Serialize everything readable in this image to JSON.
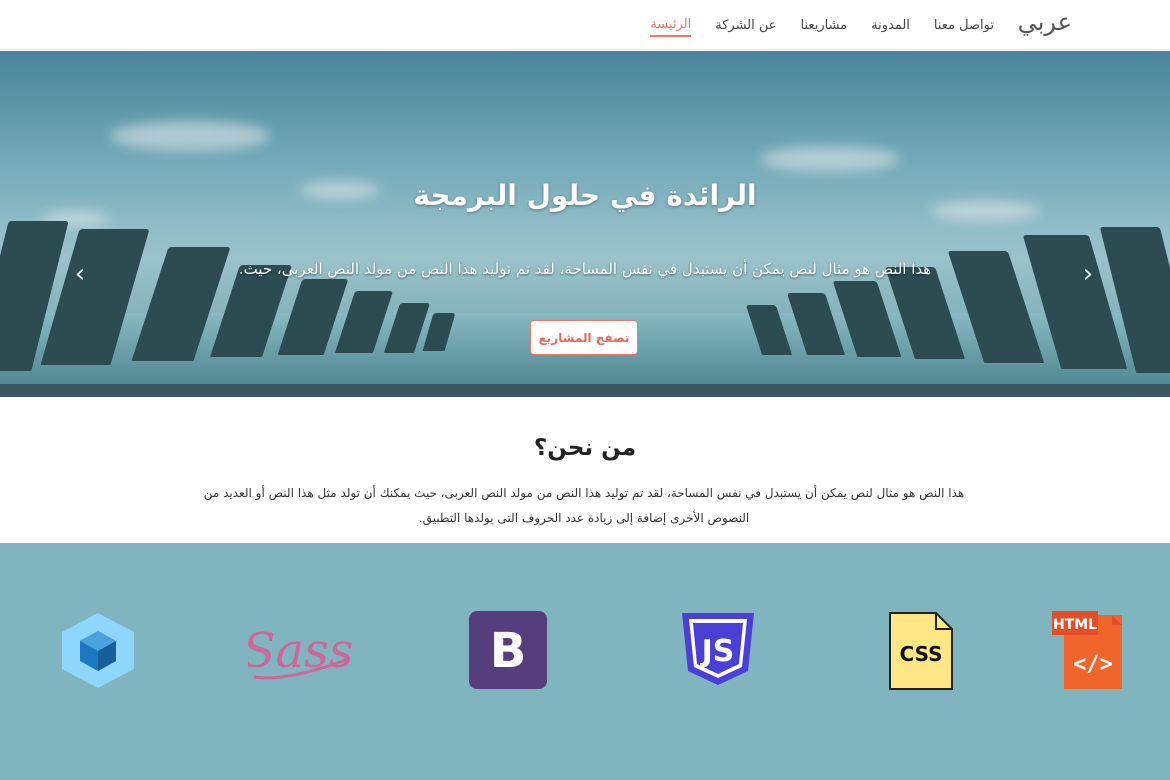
{
  "navbar": {
    "brand": "عربي",
    "items": [
      {
        "label": "الرئيسة",
        "active": true
      },
      {
        "label": "عن الشركة",
        "active": false
      },
      {
        "label": "مشاريعنا",
        "active": false
      },
      {
        "label": "المدونة",
        "active": false
      },
      {
        "label": "تواصل معنا",
        "active": false
      }
    ]
  },
  "hero": {
    "title": "الرائدة في حلول البرمجة",
    "text": "هذا النص هو مثال لنص يمكن أن يستبدل في نفس المساحة، لقد تم توليد هذا النص من مولد النص العربى، حيث.",
    "button_label": "تصفح المشاريع",
    "slides_count": 4,
    "active_slide": 3,
    "prev_icon": "chevron-left-icon",
    "next_icon": "chevron-right-icon"
  },
  "about": {
    "title": "من نحن؟",
    "text": "هذا النص هو مثال لنص يمكن أن يستبدل في نفس المساحة، لقد تم توليد هذا النص من مولد النص العربى، حيث يمكنك أن تولد مثل هذا النص أو العديد من النصوص الأخرى إضافة إلى زيادة عدد الحروف التى يولدها التطبيق."
  },
  "technologies": {
    "logos": [
      {
        "name": "html5",
        "label": "HTML",
        "color": "#f06529"
      },
      {
        "name": "css",
        "label": "CSS",
        "color": "#ffe785"
      },
      {
        "name": "javascript",
        "label": "JS",
        "color": "#4a3fd6"
      },
      {
        "name": "bootstrap",
        "label": "B",
        "color": "#563d7c"
      },
      {
        "name": "sass",
        "label": "Sass",
        "color": "#cd6799"
      },
      {
        "name": "webpack",
        "label": "",
        "color": "#8ed6fb"
      }
    ]
  },
  "colors": {
    "accent": "#f07869",
    "tech_background": "#80b4be"
  }
}
